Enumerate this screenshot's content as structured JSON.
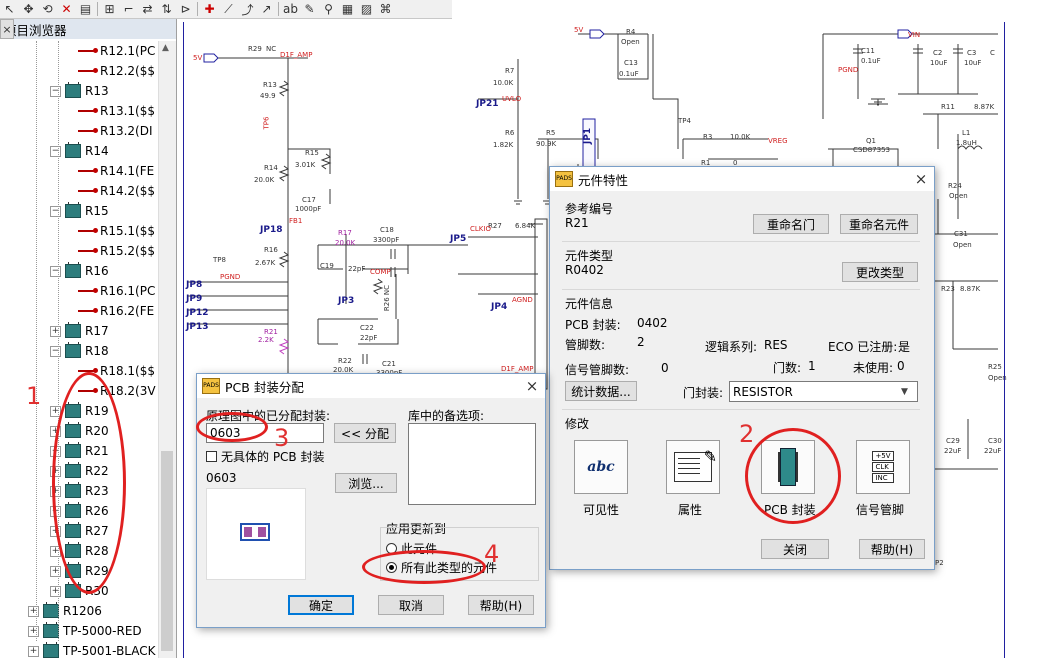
{
  "browser": {
    "title": "项目浏览器",
    "pin_glyph": "▾",
    "pin2_glyph": "⊣",
    "close_glyph": "×",
    "items": [
      {
        "kind": "pin",
        "label": "R12.1(PC",
        "indent": 2
      },
      {
        "kind": "pin",
        "label": "R12.2($$",
        "indent": 2
      },
      {
        "kind": "part",
        "label": "R13",
        "indent": 1,
        "expanded": true
      },
      {
        "kind": "pin",
        "label": "R13.1($$",
        "indent": 2
      },
      {
        "kind": "pin",
        "label": "R13.2(DI",
        "indent": 2
      },
      {
        "kind": "part",
        "label": "R14",
        "indent": 1,
        "expanded": true
      },
      {
        "kind": "pin",
        "label": "R14.1(FE",
        "indent": 2
      },
      {
        "kind": "pin",
        "label": "R14.2($$",
        "indent": 2
      },
      {
        "kind": "part",
        "label": "R15",
        "indent": 1,
        "expanded": true
      },
      {
        "kind": "pin",
        "label": "R15.1($$",
        "indent": 2
      },
      {
        "kind": "pin",
        "label": "R15.2($$",
        "indent": 2
      },
      {
        "kind": "part",
        "label": "R16",
        "indent": 1,
        "expanded": true
      },
      {
        "kind": "pin",
        "label": "R16.1(PC",
        "indent": 2
      },
      {
        "kind": "pin",
        "label": "R16.2(FE",
        "indent": 2
      },
      {
        "kind": "part",
        "label": "R17",
        "indent": 1,
        "expanded": false
      },
      {
        "kind": "part",
        "label": "R18",
        "indent": 1,
        "expanded": true
      },
      {
        "kind": "pin",
        "label": "R18.1($$",
        "indent": 2
      },
      {
        "kind": "pin",
        "label": "R18.2(3V",
        "indent": 2
      },
      {
        "kind": "part",
        "label": "R19",
        "indent": 1,
        "expanded": false
      },
      {
        "kind": "part",
        "label": "R20",
        "indent": 1,
        "expanded": false
      },
      {
        "kind": "part",
        "label": "R21",
        "indent": 1,
        "expanded": false
      },
      {
        "kind": "part",
        "label": "R22",
        "indent": 1,
        "expanded": false
      },
      {
        "kind": "part",
        "label": "R23",
        "indent": 1,
        "expanded": false
      },
      {
        "kind": "part",
        "label": "R26",
        "indent": 1,
        "expanded": false
      },
      {
        "kind": "part",
        "label": "R27",
        "indent": 1,
        "expanded": false
      },
      {
        "kind": "part",
        "label": "R28",
        "indent": 1,
        "expanded": false
      },
      {
        "kind": "part",
        "label": "R29",
        "indent": 1,
        "expanded": false
      },
      {
        "kind": "part",
        "label": "R30",
        "indent": 1,
        "expanded": false
      },
      {
        "kind": "part",
        "label": "R1206",
        "indent": 0,
        "expanded": false
      },
      {
        "kind": "part",
        "label": "TP-5000-RED",
        "indent": 0,
        "expanded": false
      },
      {
        "kind": "part",
        "label": "TP-5001-BLACK",
        "indent": 0,
        "expanded": false
      }
    ]
  },
  "schematic": {
    "labels": {
      "5v_a": "5V",
      "r29": "R29",
      "nc": "NC",
      "d1f": "D1F_AMP",
      "r13": "R13",
      "r13v": "49.9",
      "tp6": "TP6",
      "r15": "R15",
      "r15v": "3.01K",
      "r14": "R14",
      "r14v": "20.0K",
      "c17": "C17",
      "c17v": "1000pF",
      "fb1": "FB1",
      "jp18": "JP18",
      "r16": "R16",
      "r16v": "2.67K",
      "tp8": "TP8",
      "pgnd": "PGND",
      "jp8": "JP8",
      "jp9": "JP9",
      "jp12": "JP12",
      "jp13": "JP13",
      "r21": "R21",
      "r21v": "2.2K",
      "r17": "R17",
      "r17v": "20.0K",
      "c18": "C18",
      "c18v": "3300pF",
      "c19": "C19",
      "c19v": "22pF",
      "comp": "COMP",
      "jp3": "JP3",
      "r26": "R26 NC",
      "c22": "C22",
      "c22v": "22pF",
      "r22": "R22",
      "r22v": "20.0K",
      "c21": "C21",
      "c21v": "3300pF",
      "jp21": "JP21",
      "r7": "R7",
      "r7v": "10.0K",
      "uvlo": "UVLO",
      "r6": "R6",
      "r6v": "1.82K",
      "r5": "R5",
      "r5v": "90.9K",
      "jp1": "JP1",
      "5v_b": "5V",
      "r4": "R4",
      "r4v": "Open",
      "c13": "C13",
      "c13v": "0.1uF",
      "tp4": "TP4",
      "r3": "R3",
      "r3v": "10.0K",
      "vreg": "VREG",
      "r1": "R1",
      "r1v": "0",
      "jp5": "JP5",
      "r27": "R27",
      "r27v": "6.84K",
      "clkio": "CLKIO",
      "jp4": "JP4",
      "agnd": "AGND",
      "d1f_b": "D1F_AMP",
      "c11": "C11",
      "c11v": "0.1uF",
      "vin": "VIN",
      "c2": "C2",
      "c2v": "10uF",
      "c3": "C3",
      "c3v": "10uF",
      "c": "C",
      "pgnd_b": "PGND",
      "r11": "R11",
      "r11v": "8.87K",
      "l1": "L1",
      "l1v": "1.8uH",
      "q1": "Q1",
      "q1v": "CSD87353",
      "r24": "R24",
      "r24v": "Open",
      "c31": "C31",
      "c31v": "Open",
      "r23": "R23",
      "r23v": "8.87K",
      "r25": "R25",
      "r25v": "Open",
      "c29": "C29",
      "c29v": "22uF",
      "c30": "C30",
      "c30v": "22uF",
      "p2": "P2"
    }
  },
  "props": {
    "title": "元件特性",
    "close_glyph": "×",
    "ref_section": "参考编号",
    "ref_value": "R21",
    "rename_gate": "重命名门",
    "rename_part": "重命名元件",
    "type_section": "元件类型",
    "type_value": "R0402",
    "change_type": "更改类型",
    "info_section": "元件信息",
    "pcb_decal_label": "PCB 封装:",
    "pcb_decal_value": "0402",
    "pin_count_label": "管脚数:",
    "pin_count_value": "2",
    "logic_family_label": "逻辑系列:",
    "logic_family_value": "RES",
    "eco_label": "ECO 已注册:",
    "eco_value": "是",
    "signal_pins_label": "信号管脚数:",
    "signal_pins_value": "0",
    "gates_label": "门数:",
    "gates_value": "1",
    "unused_label": "未使用:",
    "unused_value": "0",
    "stats_button": "统计数据...",
    "gate_decal_label": "门封装:",
    "gate_decal_value": "RESISTOR",
    "modify_section": "修改",
    "visibility_label": "可见性",
    "attributes_label": "属性",
    "pcb_decals_label": "PCB 封装",
    "signal_pins_button_label": "信号管脚",
    "abc_glyph": "abc",
    "sig_lines": [
      "+5V",
      "CLK",
      "INC"
    ],
    "close_button": "关闭",
    "help_button": "帮助(H)"
  },
  "assign": {
    "title": "PCB 封装分配",
    "close_glyph": "×",
    "assigned_label": "原理图中的已分配封装:",
    "library_label": "库中的备选项:",
    "decal_input_value": "0603",
    "assign_button": "<< 分配",
    "no_decal_label": "无具体的 PCB 封装",
    "preview_name": "0603",
    "browse_button": "浏览...",
    "apply_group": "应用更新到",
    "radio_this": "此元件",
    "radio_all": "所有此类型的元件",
    "ok_button": "确定",
    "cancel_button": "取消",
    "help_button": "帮助(H)"
  },
  "annotations": {
    "n1": "1",
    "n2": "2",
    "n3": "3",
    "n4": "4"
  },
  "colors": {
    "annotation": "#e02020",
    "part_icon": "#2e7d7d",
    "pin_icon": "#c00000",
    "net_label": "#1a1a8a"
  }
}
